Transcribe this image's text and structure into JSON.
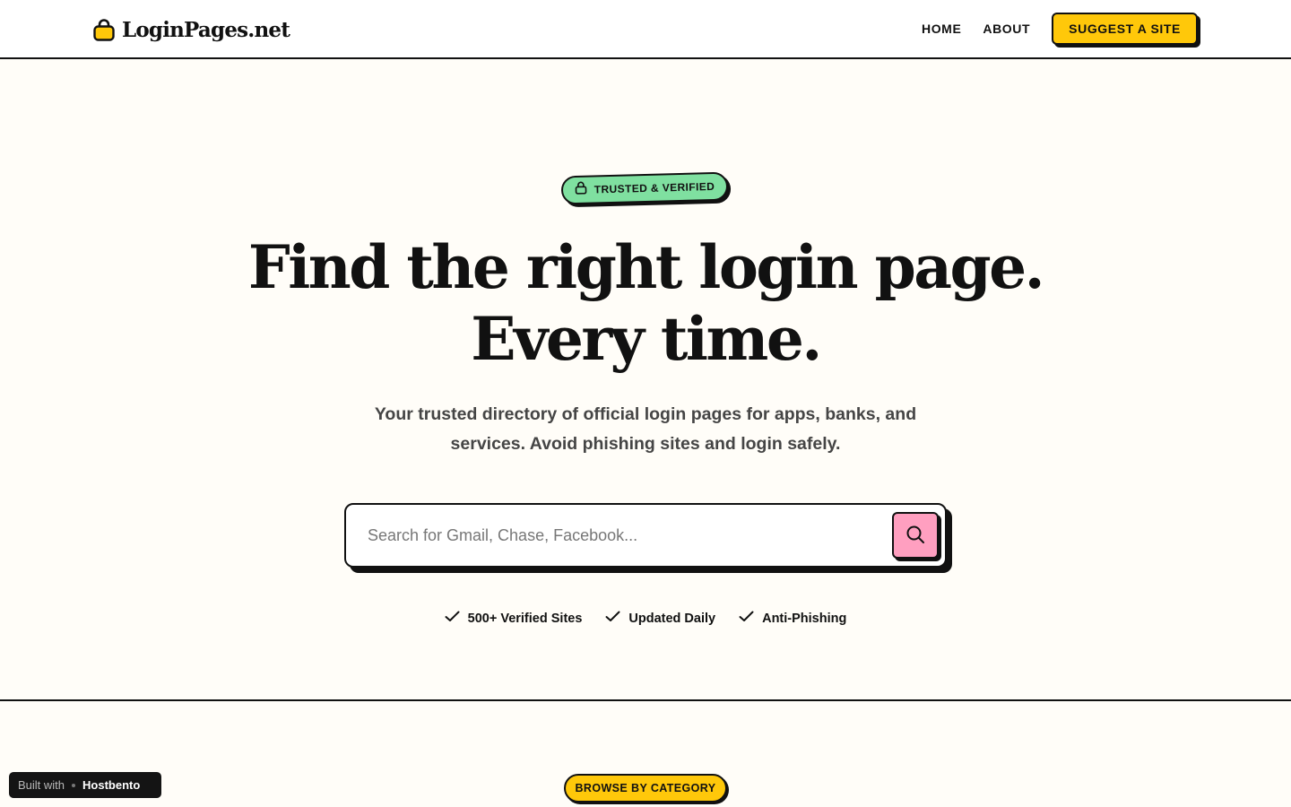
{
  "header": {
    "logo_text": "LoginPages.net",
    "nav": [
      {
        "label": "HOME"
      },
      {
        "label": "ABOUT"
      }
    ],
    "suggest_label": "SUGGEST A SITE"
  },
  "hero": {
    "badge": "TRUSTED & VERIFIED",
    "headline_line1": "Find the right login page.",
    "headline_line2": "Every time.",
    "subtext": "Your trusted directory of official login pages for apps, banks, and services. Avoid phishing sites and login safely.",
    "search": {
      "value": "",
      "placeholder": "Search for Gmail, Chase, Facebook..."
    },
    "features": [
      {
        "label": "500+ Verified Sites"
      },
      {
        "label": "Updated Daily"
      },
      {
        "label": "Anti-Phishing"
      }
    ]
  },
  "browse_label": "BROWSE BY CATEGORY",
  "built_with": {
    "label": "Built with",
    "brand": "Hostbento"
  },
  "colors": {
    "accent_yellow": "#ffc80a",
    "badge_green": "#7fe0a0",
    "search_pink": "#ff9fc0",
    "ink": "#111111",
    "hero_bg": "#fffdf8"
  },
  "icons": {
    "logo": "lock-icon",
    "badge": "lock-outline-icon",
    "search": "search-icon",
    "feature": "check-icon"
  }
}
